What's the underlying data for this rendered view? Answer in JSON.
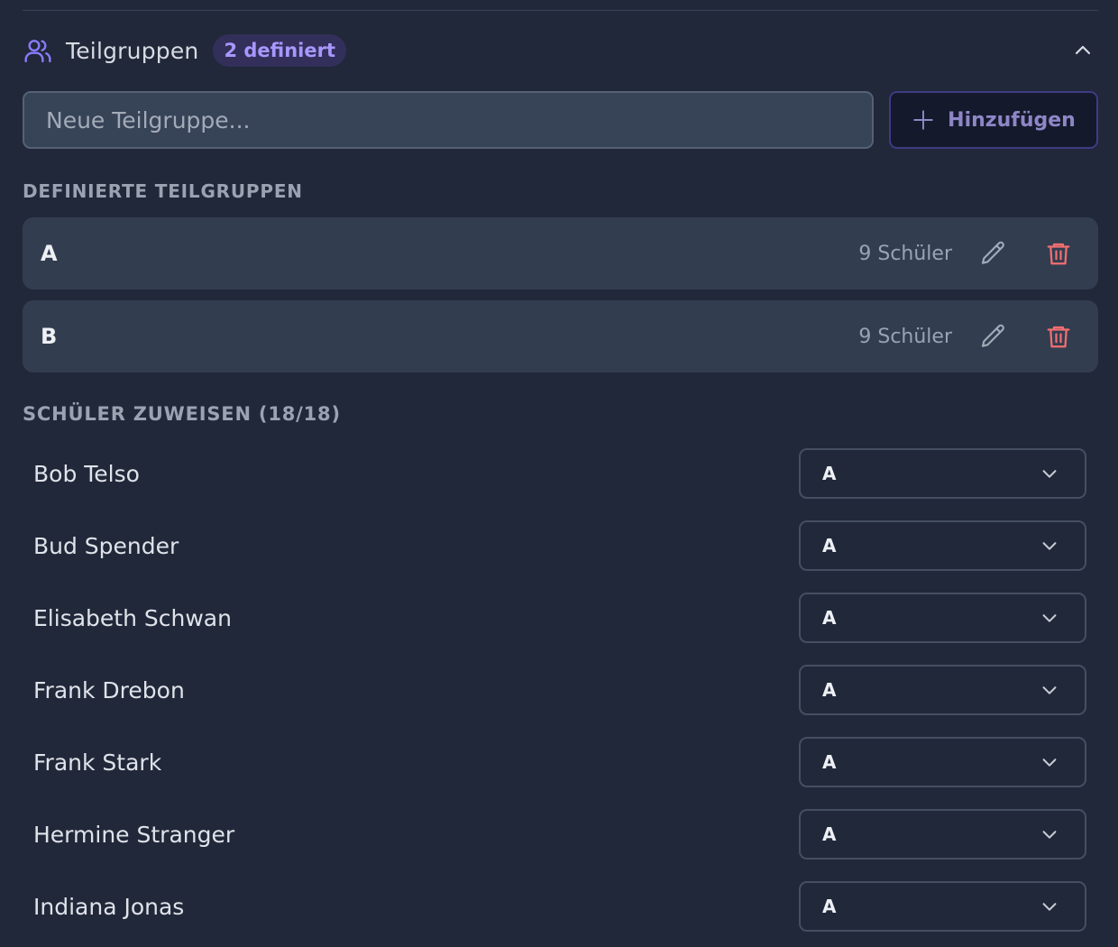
{
  "section": {
    "title": "Teilgruppen",
    "badge": "2 definiert"
  },
  "new_group": {
    "placeholder": "Neue Teilgruppe...",
    "value": "",
    "add_label": "Hinzufügen"
  },
  "labels": {
    "defined": "DEFINIERTE TEILGRUPPEN",
    "assign": "SCHÜLER ZUWEISEN (18/18)"
  },
  "groups": [
    {
      "name": "A",
      "count": "9 Schüler"
    },
    {
      "name": "B",
      "count": "9 Schüler"
    }
  ],
  "students": [
    {
      "name": "Bob Telso",
      "group": "A"
    },
    {
      "name": "Bud Spender",
      "group": "A"
    },
    {
      "name": "Elisabeth Schwan",
      "group": "A"
    },
    {
      "name": "Frank Drebon",
      "group": "A"
    },
    {
      "name": "Frank Stark",
      "group": "A"
    },
    {
      "name": "Hermine Stranger",
      "group": "A"
    },
    {
      "name": "Indiana Jonas",
      "group": "A"
    }
  ],
  "colors": {
    "background": "#212839",
    "card": "#323d50",
    "accent": "#a897ff",
    "badge_bg": "#322f5a",
    "danger": "#f26f6f"
  },
  "icons": {
    "section": "users-icon",
    "toggle": "chevron-up-icon",
    "add": "plus-icon",
    "edit": "pencil-icon",
    "delete": "trash-icon",
    "select": "chevron-down-icon"
  }
}
